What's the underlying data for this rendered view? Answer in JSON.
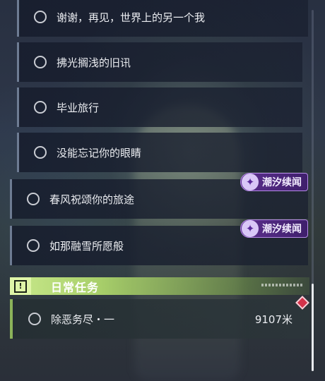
{
  "quests": [
    {
      "label": "谢谢，再见，世界上的另一个我"
    },
    {
      "label": "拂光搁浅的旧讯"
    },
    {
      "label": "毕业旅行"
    },
    {
      "label": "没能忘记你的眼睛"
    },
    {
      "label": "春风祝颂你的旅途",
      "tag": "潮汐续闻"
    },
    {
      "label": "如那融雪所愿般",
      "tag": "潮汐续闻"
    }
  ],
  "daily": {
    "header": "日常任务",
    "header_icon": "!",
    "quest_label": "除恶务尽・一",
    "distance": "9107米"
  },
  "colors": {
    "daily_accent": "#a8cf6a",
    "tag_purple": "#5c2f8e",
    "marker_red": "#d3324a"
  },
  "icons": {
    "tag_icon": "tide-story-icon",
    "quest_status": "circle-icon",
    "tracker_marker": "diamond-marker-icon"
  }
}
